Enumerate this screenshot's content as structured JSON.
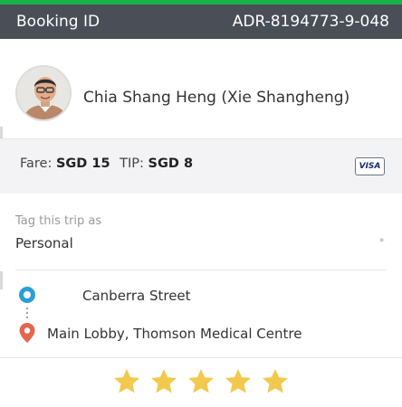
{
  "header": {
    "label": "Booking ID",
    "booking_id": "ADR-8194773-9-048",
    "accent_color": "#18b34a",
    "background_color": "#4a4e57"
  },
  "driver": {
    "name": "Chia Shang Heng (Xie Shangheng)",
    "avatar_icon": "driver-photo"
  },
  "fare": {
    "fare_label": "Fare:",
    "fare_value": "SGD 15",
    "tip_label": "TIP:",
    "tip_value": "SGD 8",
    "payment_card": "VISA"
  },
  "trip_tag": {
    "label": "Tag this trip as",
    "value": "Personal",
    "chevron_icon": "chevron-right-icon"
  },
  "route": {
    "pickup": "Canberra Street",
    "dropoff": "Main Lobby, Thomson Medical Centre",
    "pickup_color": "#2a9fd6",
    "dropoff_color": "#e4664f"
  },
  "rating": {
    "stars": 5,
    "max": 5,
    "star_color": "#f2c94c"
  }
}
